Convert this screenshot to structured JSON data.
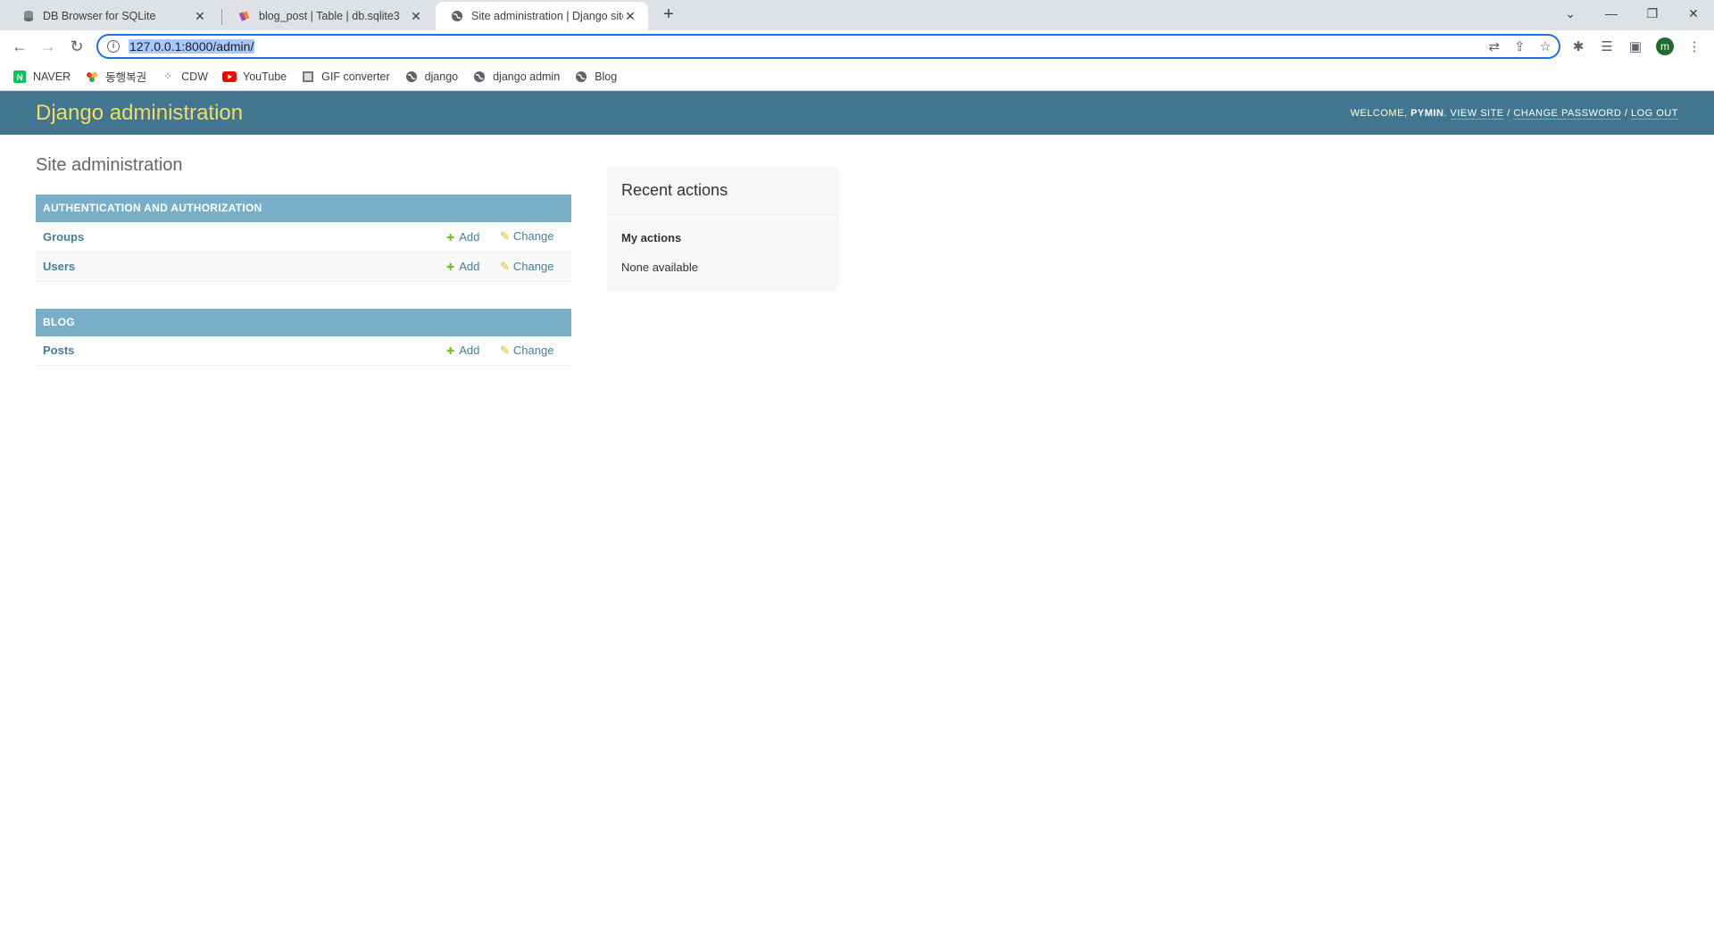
{
  "browser": {
    "tabs": [
      {
        "title": "DB Browser for SQLite",
        "icon": "database-icon"
      },
      {
        "title": "blog_post | Table | db.sqlite3",
        "icon": "brush-icon"
      },
      {
        "title": "Site administration | Django site",
        "icon": "globe-icon",
        "active": true
      }
    ],
    "url": "127.0.0.1:8000/admin/",
    "bookmarks": [
      {
        "label": "NAVER",
        "icon": "naver-icon",
        "color": "#03c75a"
      },
      {
        "label": "동행복권",
        "icon": "lottery-icon",
        "color": "#e53935"
      },
      {
        "label": "CDW",
        "icon": "cdw-icon",
        "color": "#333333"
      },
      {
        "label": "YouTube",
        "icon": "youtube-icon",
        "color": "#ff0000"
      },
      {
        "label": "GIF converter",
        "icon": "gif-icon",
        "color": "#555555"
      },
      {
        "label": "django",
        "icon": "globe-icon",
        "color": "#555555"
      },
      {
        "label": "django admin",
        "icon": "globe-icon",
        "color": "#555555"
      },
      {
        "label": "Blog",
        "icon": "globe-icon",
        "color": "#555555"
      }
    ],
    "profile_initial": "m"
  },
  "admin": {
    "brand": "Django administration",
    "welcome": "Welcome,",
    "user": "pymin",
    "view_site": "View site",
    "change_password": "Change password",
    "log_out": "Log out",
    "page_title": "Site administration",
    "modules": [
      {
        "caption": "Authentication and Authorization",
        "rows": [
          {
            "name": "Groups",
            "add": "Add",
            "change": "Change"
          },
          {
            "name": "Users",
            "add": "Add",
            "change": "Change"
          }
        ]
      },
      {
        "caption": "Blog",
        "rows": [
          {
            "name": "Posts",
            "add": "Add",
            "change": "Change"
          }
        ]
      }
    ],
    "recent": {
      "title": "Recent actions",
      "subtitle": "My actions",
      "empty": "None available"
    }
  },
  "colors": {
    "header_bg": "#417690",
    "brand": "#f5dd5d",
    "module_caption": "#79aec8",
    "link": "#447e9b",
    "add_icon": "#70bf2b",
    "change_icon": "#efb80b"
  }
}
